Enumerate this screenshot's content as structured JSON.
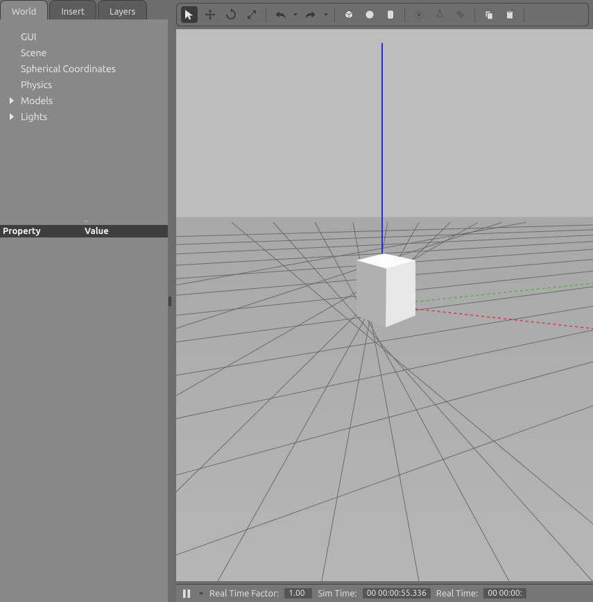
{
  "tabs": {
    "world": "World",
    "insert": "Insert",
    "layers": "Layers"
  },
  "tree": {
    "gui": "GUI",
    "scene": "Scene",
    "spherical": "Spherical Coordinates",
    "physics": "Physics",
    "models": "Models",
    "lights": "Lights"
  },
  "prop": {
    "header_property": "Property",
    "header_value": "Value"
  },
  "status": {
    "rtf_label": "Real Time Factor:",
    "rtf_value": "1.00",
    "sim_label": "Sim Time:",
    "sim_value": "00 00:00:55.336",
    "real_label": "Real Time:",
    "real_value": "00 00:00:"
  }
}
